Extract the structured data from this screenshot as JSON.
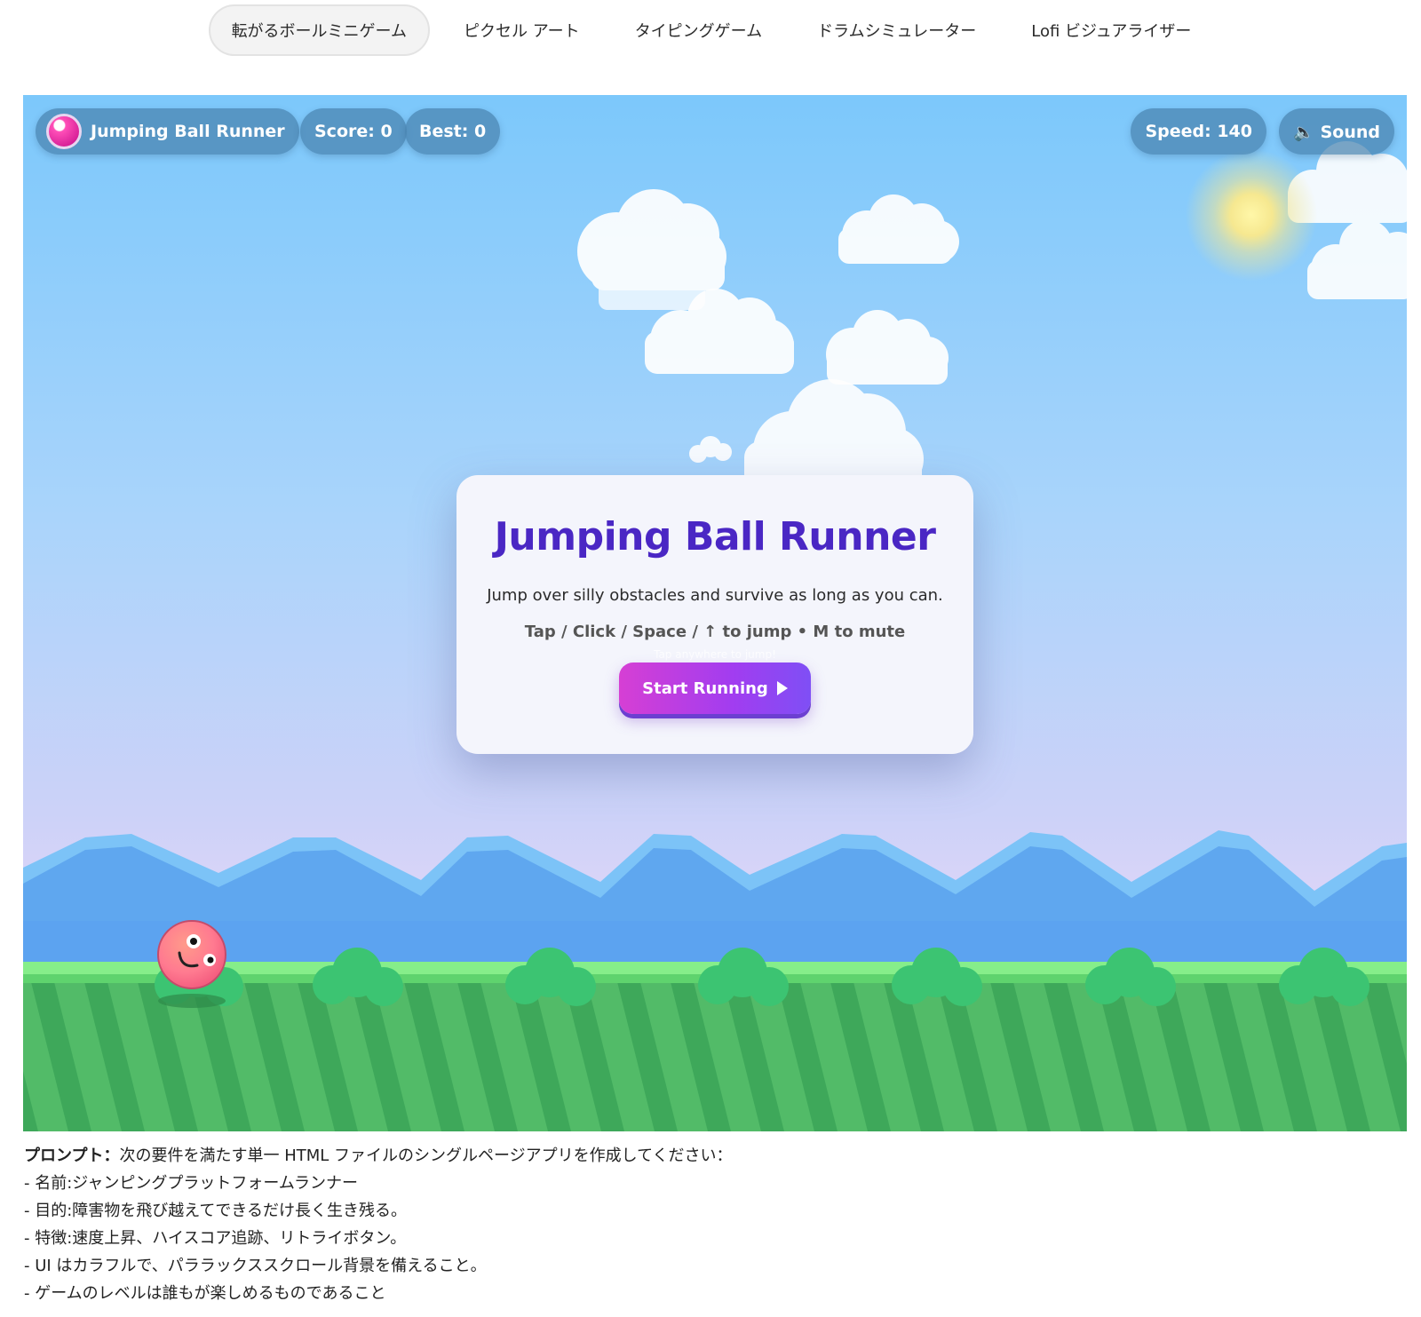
{
  "tabs": [
    {
      "label": "転がるボールミニゲーム",
      "active": true
    },
    {
      "label": "ピクセル アート",
      "active": false
    },
    {
      "label": "タイピングゲーム",
      "active": false
    },
    {
      "label": "ドラムシミュレーター",
      "active": false
    },
    {
      "label": "Lofi ビジュアライザー",
      "active": false
    }
  ],
  "hud": {
    "game_name": "Jumping Ball Runner",
    "score": "Score: 0",
    "best": "Best: 0",
    "speed": "Speed: 140",
    "sound": "🔈 Sound"
  },
  "modal": {
    "title": "Jumping Ball Runner",
    "description": "Jump over silly obstacles and survive as long as you can.",
    "controls": "Tap / Click / Space / ↑ to jump • M to mute",
    "hint": "Tap anywhere to jump!",
    "start_label": "Start Running"
  },
  "prompt": {
    "heading": "プロンプト：",
    "intro": "次の要件を満たす単一 HTML ファイルのシングルページアプリを作成してください：",
    "lines": [
      "- 名前:ジャンピングプラットフォームランナー",
      "- 目的:障害物を飛び越えてできるだけ長く生き残る。",
      "- 特徴:速度上昇、ハイスコア追跡、リトライボタン。",
      "- UI はカラフルで、パララックススクロール背景を備えること。",
      "- ゲームのレベルは誰もが楽しめるものであること"
    ]
  },
  "colors": {
    "title": "#4a27c4",
    "grass_light": "#6ee07c",
    "grass_dark": "#3aa75a",
    "bush": "#3cc472",
    "mountain_far": "#7cbff5",
    "mountain_near": "#5aa2ef",
    "ball": "#ff7d8e"
  }
}
